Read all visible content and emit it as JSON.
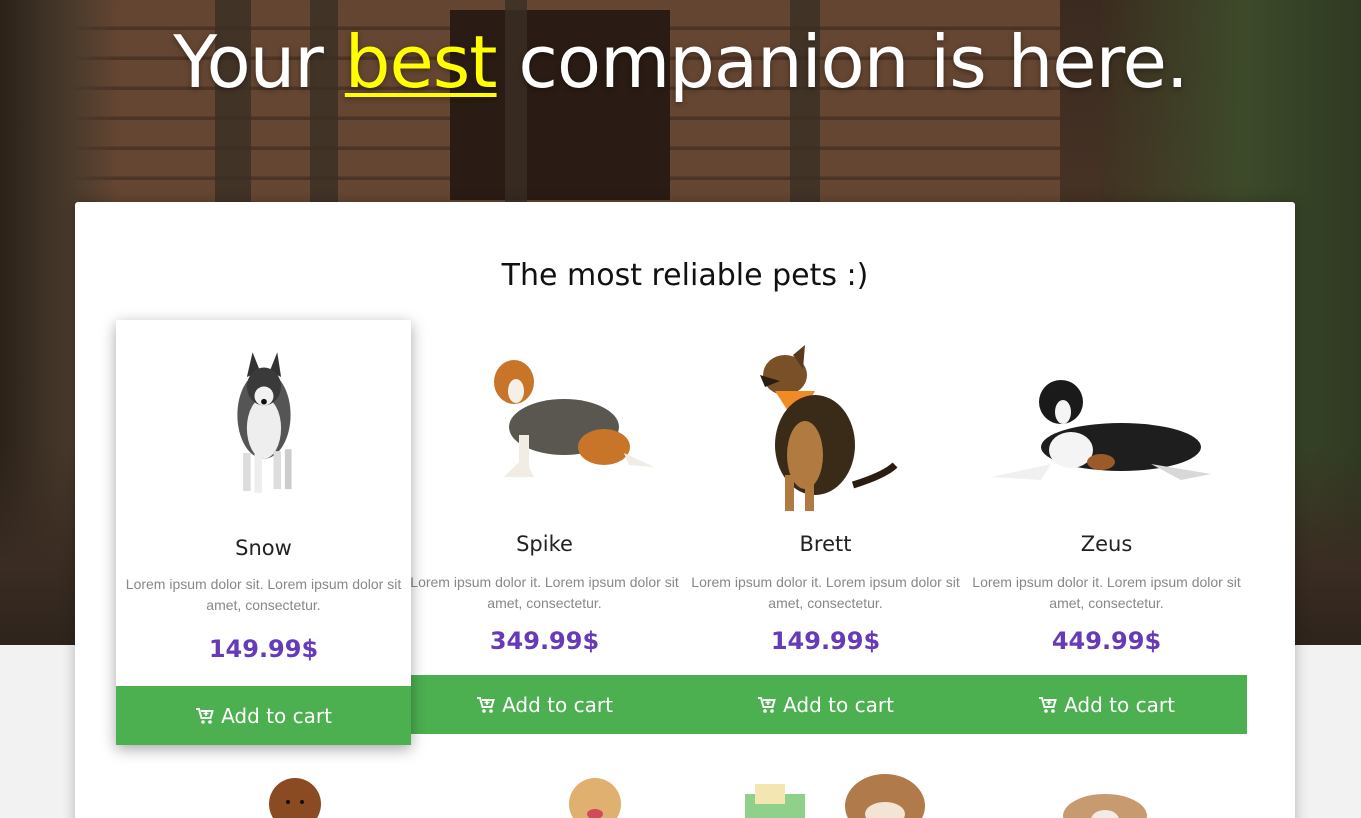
{
  "hero": {
    "headline_before": "Your ",
    "headline_accent": "best",
    "headline_after": " companion is here.",
    "accent_color": "#ffff00"
  },
  "section": {
    "title": "The most reliable pets :)"
  },
  "colors": {
    "price": "#673ab7",
    "cart_button": "#4caf50"
  },
  "pets": [
    {
      "name": "Snow",
      "description": "Lorem ipsum dolor sit. Lorem ipsum dolor sit amet, consectetur.",
      "price": "149.99$",
      "button": "Add to cart",
      "image": "husky-dog-photo"
    },
    {
      "name": "Spike",
      "description": "Lorem ipsum dolor it. Lorem ipsum dolor sit amet, consectetur.",
      "price": "349.99$",
      "button": "Add to cart",
      "image": "beagle-dog-photo"
    },
    {
      "name": "Brett",
      "description": "Lorem ipsum dolor it. Lorem ipsum dolor sit amet, consectetur.",
      "price": "149.99$",
      "button": "Add to cart",
      "image": "shepherd-dog-photo"
    },
    {
      "name": "Zeus",
      "description": "Lorem ipsum dolor it. Lorem ipsum dolor sit amet, consectetur.",
      "price": "449.99$",
      "button": "Add to cart",
      "image": "bernese-dog-photo"
    }
  ]
}
